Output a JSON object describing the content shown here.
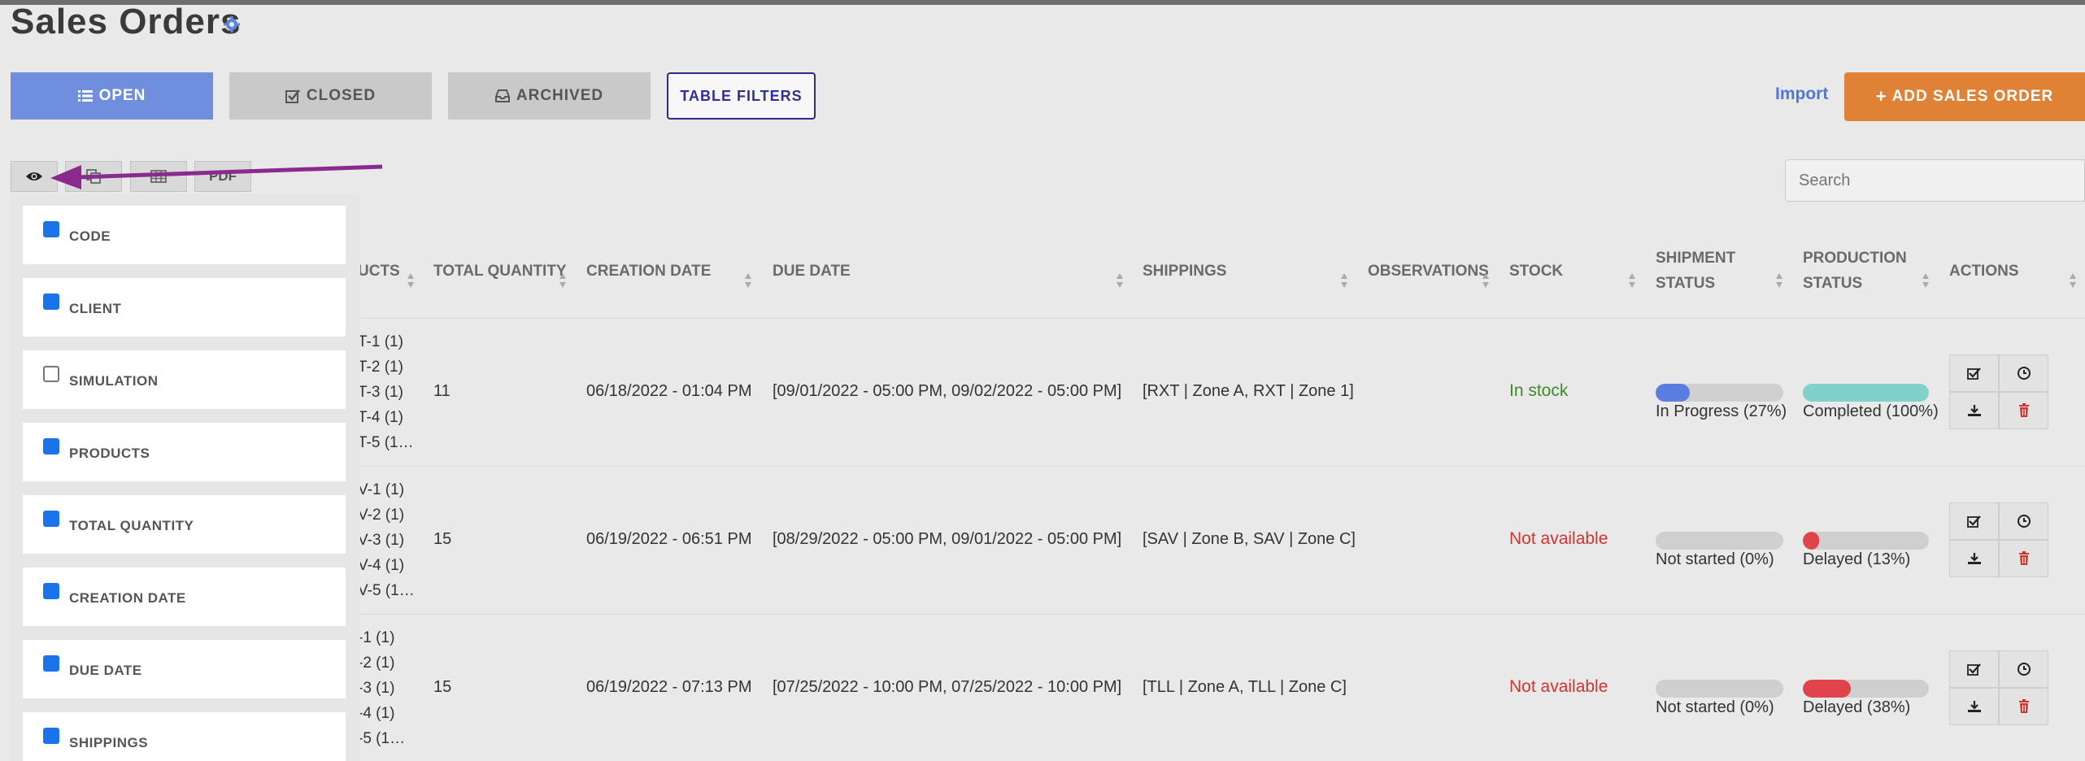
{
  "page": {
    "title": "Sales Orders"
  },
  "tabs": {
    "open": "OPEN",
    "closed": "CLOSED",
    "archived": "ARCHIVED",
    "filters": "TABLE FILTERS"
  },
  "actions": {
    "import": "Import",
    "add": "ADD SALES ORDER"
  },
  "toolbar": {
    "pdf": "PDF"
  },
  "search": {
    "placeholder": "Search"
  },
  "columns": {
    "products": "UCTS",
    "total_quantity": "TOTAL QUANTITY",
    "creation_date": "CREATION DATE",
    "due_date": "DUE DATE",
    "shippings": "SHIPPINGS",
    "observations": "OBSERVATIONS",
    "stock": "STOCK",
    "shipment_status": [
      "SHIPMENT",
      "STATUS"
    ],
    "production_status": [
      "PRODUCTION",
      "STATUS"
    ],
    "actions": "ACTIONS"
  },
  "rows": [
    {
      "products": [
        "T-1 (1)",
        "T-2 (1)",
        "T-3 (1)",
        "T-4 (1)",
        "T-5 (1…"
      ],
      "total_quantity": "11",
      "creation_date": "06/18/2022 - 01:04 PM",
      "due_date": "[09/01/2022 - 05:00 PM, 09/02/2022 - 05:00 PM]",
      "shippings": "[RXT | Zone A, RXT | Zone 1]",
      "stock": "In stock",
      "shipment": {
        "label": "In Progress (27%)",
        "progress": 0.27
      },
      "production": {
        "label": "Completed (100%)",
        "progress": 1.0
      }
    },
    {
      "products": [
        "V-1 (1)",
        "V-2 (1)",
        "V-3 (1)",
        "V-4 (1)",
        "V-5 (1…"
      ],
      "total_quantity": "15",
      "creation_date": "06/19/2022 - 06:51 PM",
      "due_date": "[08/29/2022 - 05:00 PM, 09/01/2022 - 05:00 PM]",
      "shippings": "[SAV | Zone B, SAV | Zone C]",
      "stock": "Not available",
      "shipment": {
        "label": "Not started (0%)",
        "progress": 0
      },
      "production": {
        "label": "Delayed (13%)",
        "progress": 0.13
      }
    },
    {
      "products": [
        "-1 (1)",
        "-2 (1)",
        "-3 (1)",
        "-4 (1)",
        "-5 (1…"
      ],
      "total_quantity": "15",
      "creation_date": "06/19/2022 - 07:13 PM",
      "due_date": "[07/25/2022 - 10:00 PM, 07/25/2022 - 10:00 PM]",
      "shippings": "[TLL | Zone A, TLL | Zone C]",
      "stock": "Not available",
      "shipment": {
        "label": "Not started (0%)",
        "progress": 0
      },
      "production": {
        "label": "Delayed (38%)",
        "progress": 0.38
      }
    }
  ],
  "column_options": [
    {
      "label": "CODE",
      "checked": true
    },
    {
      "label": "CLIENT",
      "checked": true
    },
    {
      "label": "SIMULATION",
      "checked": false
    },
    {
      "label": "PRODUCTS",
      "checked": true
    },
    {
      "label": "TOTAL QUANTITY",
      "checked": true
    },
    {
      "label": "CREATION DATE",
      "checked": true
    },
    {
      "label": "DUE DATE",
      "checked": true
    },
    {
      "label": "SHIPPINGS",
      "checked": true
    }
  ],
  "colors": {
    "open_tab": "#6f8fde",
    "add_button": "#e08236",
    "in_stock": "#3c8a2e",
    "not_available": "#d0342c",
    "shipment_progress": "#5a7ee0",
    "production_complete": "#7fd1c9",
    "production_delayed": "#e0434a",
    "annotation_arrow": "#8a2a8e"
  }
}
